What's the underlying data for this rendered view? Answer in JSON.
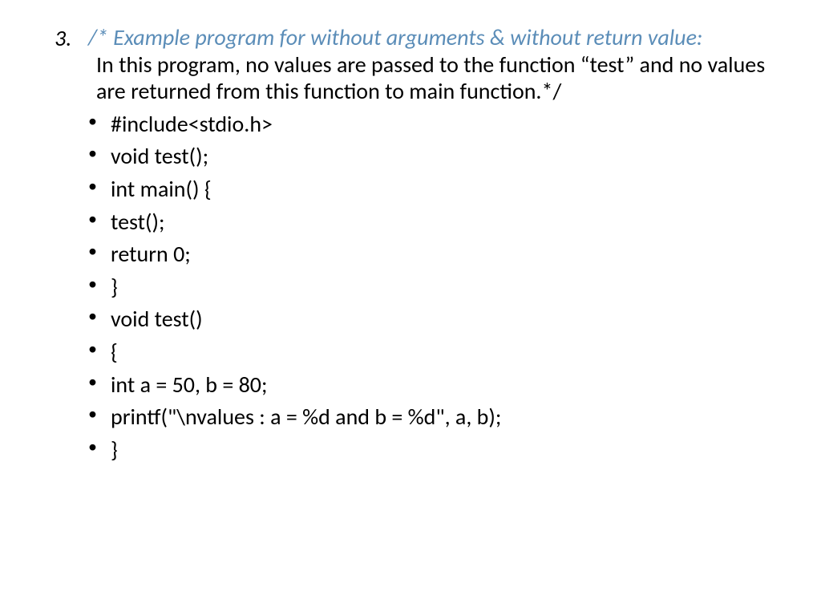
{
  "slide": {
    "number": "3.",
    "comment_open": "/* ",
    "title": "Example program for without arguments & without return value:",
    "description": "In this program, no values are passed to the function “test” and no values are returned from this function to main function.*/",
    "code_lines": [
      "#include<stdio.h>",
      "void test();",
      "int main()   {",
      "test();",
      "return 0;",
      "}",
      "void test()",
      "{",
      "int a = 50, b = 80;",
      "printf(\"\\nvalues : a = %d and b = %d\", a, b);",
      "}"
    ]
  }
}
